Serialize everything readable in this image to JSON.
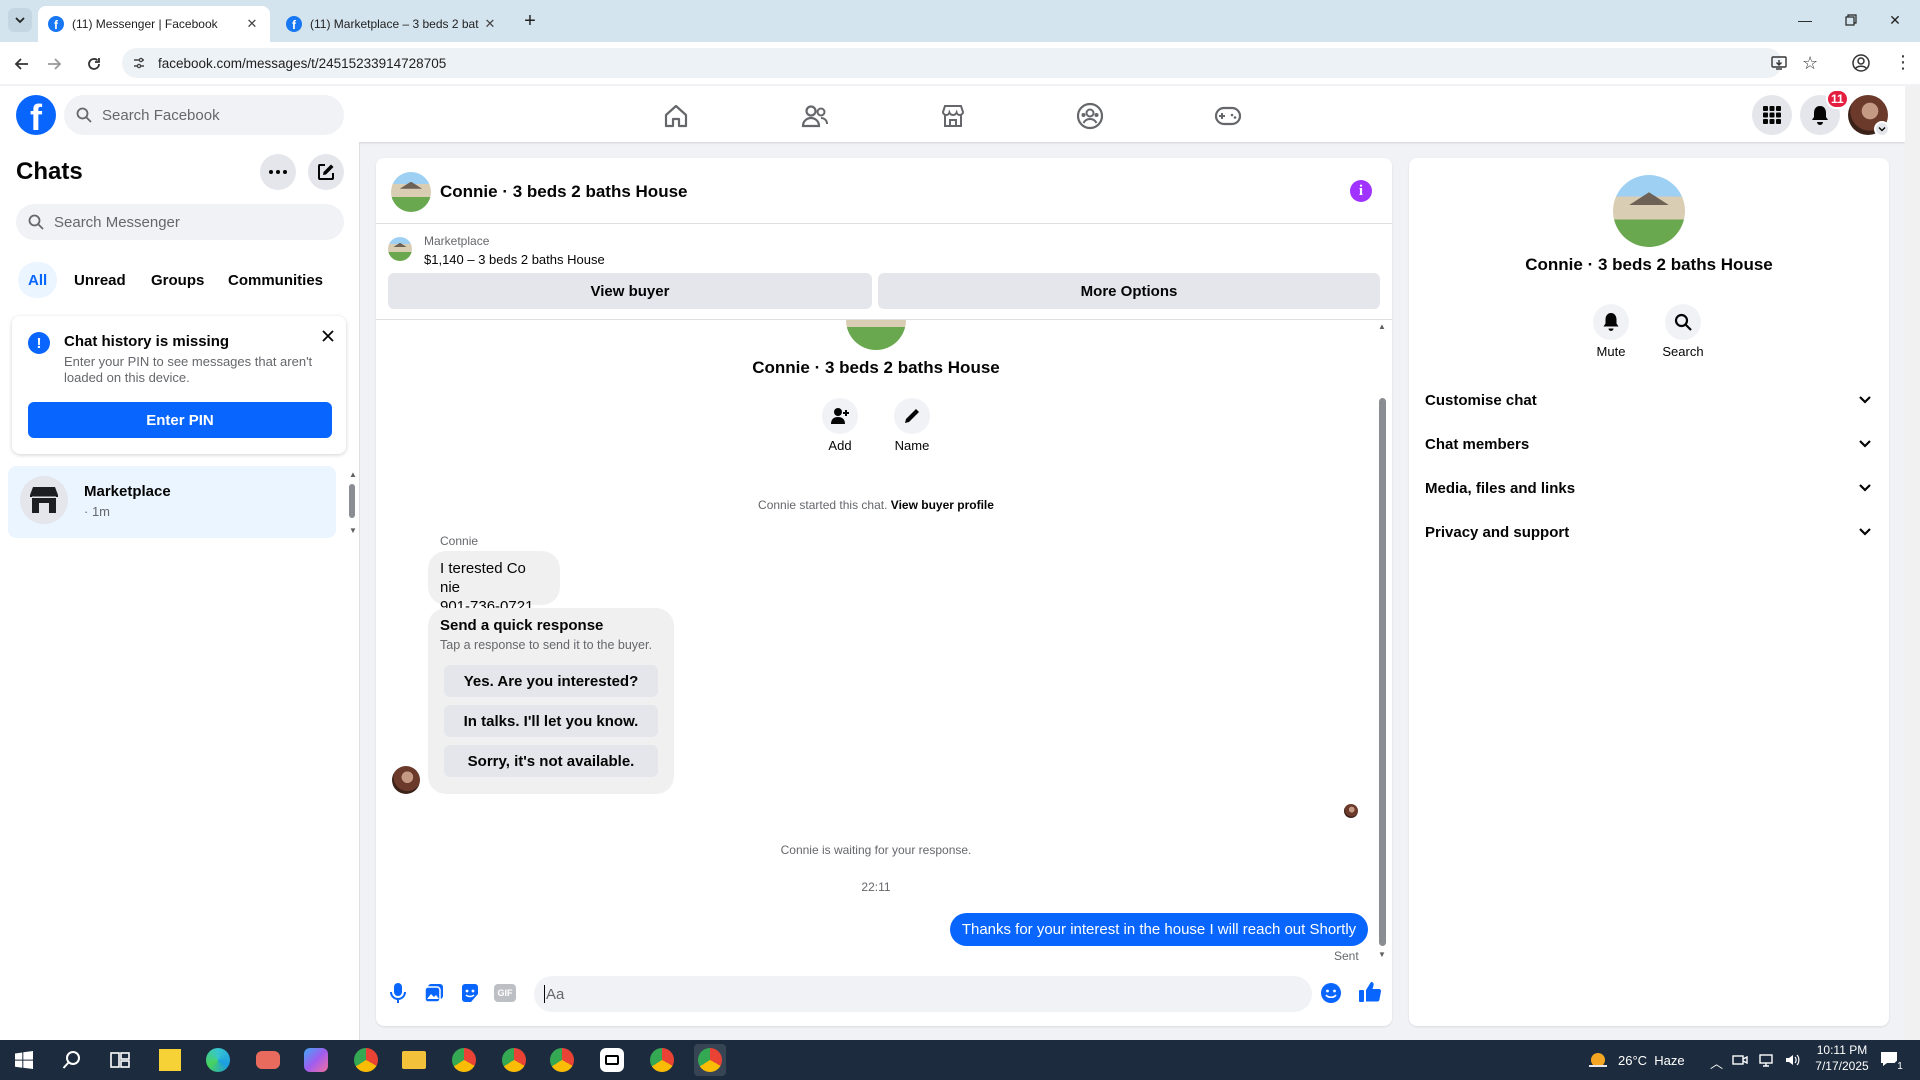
{
  "browser": {
    "tabs": [
      {
        "title": "(11) Messenger | Facebook",
        "active": true
      },
      {
        "title": "(11) Marketplace – 3 beds 2 bat",
        "active": false
      }
    ],
    "url": "facebook.com/messages/t/24515233914728705"
  },
  "header": {
    "search_placeholder": "Search Facebook",
    "notification_count": "11",
    "nav_icons": [
      "home-icon",
      "friends-icon",
      "marketplace-icon",
      "groups-icon",
      "gaming-icon"
    ]
  },
  "chats": {
    "title": "Chats",
    "search_placeholder": "Search Messenger",
    "filters": [
      "All",
      "Unread",
      "Groups",
      "Communities"
    ],
    "history_notice": {
      "title": "Chat history is missing",
      "body": "Enter your PIN to see messages that aren't loaded on this device.",
      "button": "Enter PIN"
    },
    "items": [
      {
        "name": "Marketplace",
        "meta": "· 1m"
      }
    ]
  },
  "conversation": {
    "title": "Connie · 3 beds 2 baths House",
    "listing": {
      "source": "Marketplace",
      "summary": "$1,140 – 3 beds 2 baths House",
      "view_buyer": "View buyer",
      "more_options": "More Options"
    },
    "intro": {
      "name": "Connie · 3 beds 2 baths House",
      "add_label": "Add",
      "name_label": "Name",
      "started_text": "Connie started this chat.",
      "buyer_profile_link": "View buyer profile"
    },
    "incoming": {
      "sender": "Connie",
      "line1": "I terested Co nie",
      "line2": "901-736-0721"
    },
    "quick_response": {
      "title": "Send a quick response",
      "subtitle": "Tap a response to send it to the buyer.",
      "options": [
        "Yes. Are you interested?",
        "In talks. I'll let you know.",
        "Sorry, it's not available."
      ]
    },
    "waiting_text": "Connie is waiting for your response.",
    "timestamp": "22:11",
    "outgoing": "Thanks for your interest in the house I will reach out Shortly",
    "status": "Sent",
    "composer_placeholder": "Aa"
  },
  "info_panel": {
    "name": "Connie · 3 beds 2 baths House",
    "mute_label": "Mute",
    "search_label": "Search",
    "sections": [
      "Customise chat",
      "Chat members",
      "Media, files and links",
      "Privacy and support"
    ]
  },
  "taskbar": {
    "weather": "26°C  Haze",
    "time": "10:11 PM",
    "date": "7/17/2025",
    "notification_count": "1"
  },
  "colors": {
    "brand": "#0866ff",
    "accent_purple": "#a033ff",
    "badge_red": "#e41e3f"
  }
}
